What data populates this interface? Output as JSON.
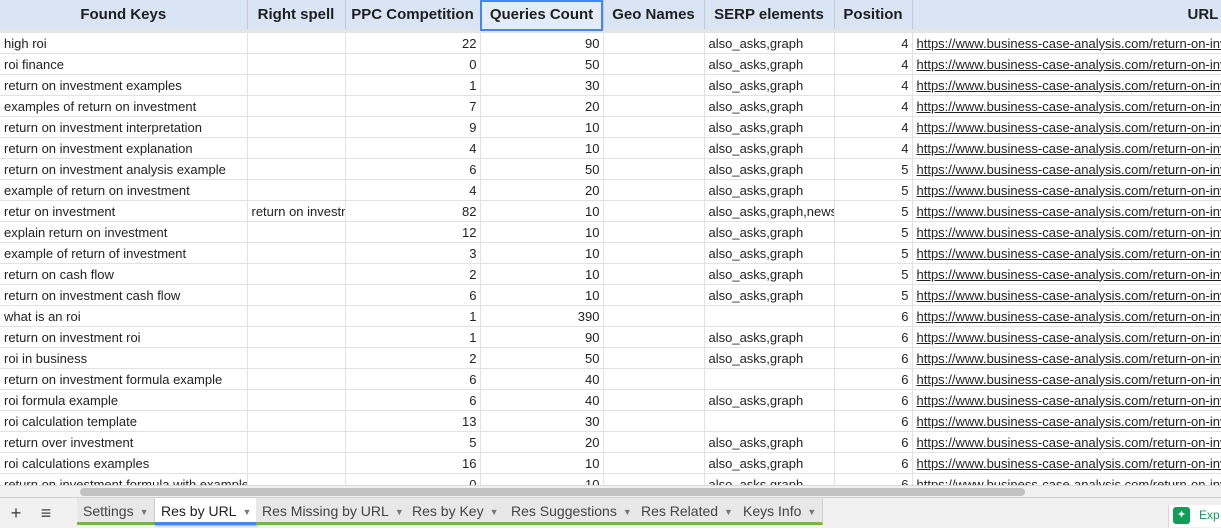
{
  "headers": [
    "Found Keys",
    "Right spell",
    "PPC Competition",
    "Queries Count",
    "Geo Names",
    "SERP elements",
    "Position",
    "URL"
  ],
  "selected_header": "Queries Count",
  "url_value": "https://www.business-case-analysis.com/return-on-investment.html",
  "rows": [
    {
      "key": "high roi",
      "spell": "",
      "ppc": "22",
      "queries": "90",
      "geo": "",
      "serp": "also_asks,graph",
      "position": "4"
    },
    {
      "key": "roi finance",
      "spell": "",
      "ppc": "0",
      "queries": "50",
      "geo": "",
      "serp": "also_asks,graph",
      "position": "4"
    },
    {
      "key": "return on investment examples",
      "spell": "",
      "ppc": "1",
      "queries": "30",
      "geo": "",
      "serp": "also_asks,graph",
      "position": "4"
    },
    {
      "key": "examples of return on investment",
      "spell": "",
      "ppc": "7",
      "queries": "20",
      "geo": "",
      "serp": "also_asks,graph",
      "position": "4"
    },
    {
      "key": "return on investment interpretation",
      "spell": "",
      "ppc": "9",
      "queries": "10",
      "geo": "",
      "serp": "also_asks,graph",
      "position": "4"
    },
    {
      "key": "return on investment explanation",
      "spell": "",
      "ppc": "4",
      "queries": "10",
      "geo": "",
      "serp": "also_asks,graph",
      "position": "4"
    },
    {
      "key": "return on investment analysis example",
      "spell": "",
      "ppc": "6",
      "queries": "50",
      "geo": "",
      "serp": "also_asks,graph",
      "position": "5"
    },
    {
      "key": "example of return on investment",
      "spell": "",
      "ppc": "4",
      "queries": "20",
      "geo": "",
      "serp": "also_asks,graph",
      "position": "5"
    },
    {
      "key": "retur on investment",
      "spell": "return on investment",
      "ppc": "82",
      "queries": "10",
      "geo": "",
      "serp": "also_asks,graph,news",
      "position": "5"
    },
    {
      "key": "explain return on investment",
      "spell": "",
      "ppc": "12",
      "queries": "10",
      "geo": "",
      "serp": "also_asks,graph",
      "position": "5"
    },
    {
      "key": "example of return of investment",
      "spell": "",
      "ppc": "3",
      "queries": "10",
      "geo": "",
      "serp": "also_asks,graph",
      "position": "5"
    },
    {
      "key": "return on cash flow",
      "spell": "",
      "ppc": "2",
      "queries": "10",
      "geo": "",
      "serp": "also_asks,graph",
      "position": "5"
    },
    {
      "key": "return on investment cash flow",
      "spell": "",
      "ppc": "6",
      "queries": "10",
      "geo": "",
      "serp": "also_asks,graph",
      "position": "5"
    },
    {
      "key": "what is an roi",
      "spell": "",
      "ppc": "1",
      "queries": "390",
      "geo": "",
      "serp": "",
      "position": "6"
    },
    {
      "key": "return on investment roi",
      "spell": "",
      "ppc": "1",
      "queries": "90",
      "geo": "",
      "serp": "also_asks,graph",
      "position": "6"
    },
    {
      "key": "roi in business",
      "spell": "",
      "ppc": "2",
      "queries": "50",
      "geo": "",
      "serp": "also_asks,graph",
      "position": "6"
    },
    {
      "key": "return on investment formula example",
      "spell": "",
      "ppc": "6",
      "queries": "40",
      "geo": "",
      "serp": "",
      "position": "6"
    },
    {
      "key": "roi formula example",
      "spell": "",
      "ppc": "6",
      "queries": "40",
      "geo": "",
      "serp": "also_asks,graph",
      "position": "6"
    },
    {
      "key": "roi calculation template",
      "spell": "",
      "ppc": "13",
      "queries": "30",
      "geo": "",
      "serp": "",
      "position": "6"
    },
    {
      "key": "return over investment",
      "spell": "",
      "ppc": "5",
      "queries": "20",
      "geo": "",
      "serp": "also_asks,graph",
      "position": "6"
    },
    {
      "key": "roi calculations examples",
      "spell": "",
      "ppc": "16",
      "queries": "10",
      "geo": "",
      "serp": "also_asks,graph",
      "position": "6"
    },
    {
      "key": "return on investment formula with example",
      "spell": "",
      "ppc": "0",
      "queries": "10",
      "geo": "",
      "serp": "also_asks,graph",
      "position": "6"
    }
  ],
  "tabbar": {
    "add_icon": "+",
    "menu_icon": "≡",
    "tabs": [
      {
        "label": "Settings",
        "active": false
      },
      {
        "label": "Res by URL",
        "active": true
      },
      {
        "label": "Res Missing by URL",
        "active": false
      },
      {
        "label": "Res by Key",
        "active": false
      },
      {
        "label": "Res Suggestions",
        "active": false
      },
      {
        "label": "Res Related",
        "active": false
      },
      {
        "label": "Keys Info",
        "active": false
      }
    ],
    "arrow_glyph": "▼"
  },
  "explore": {
    "label": "Exp",
    "icon": "explore-icon",
    "color": "#0f9d58"
  },
  "colors": {
    "header_bg": "#d9e5f5",
    "link": "#1155cc",
    "tab_underline": "#7cb342",
    "selection": "#4285f4"
  }
}
